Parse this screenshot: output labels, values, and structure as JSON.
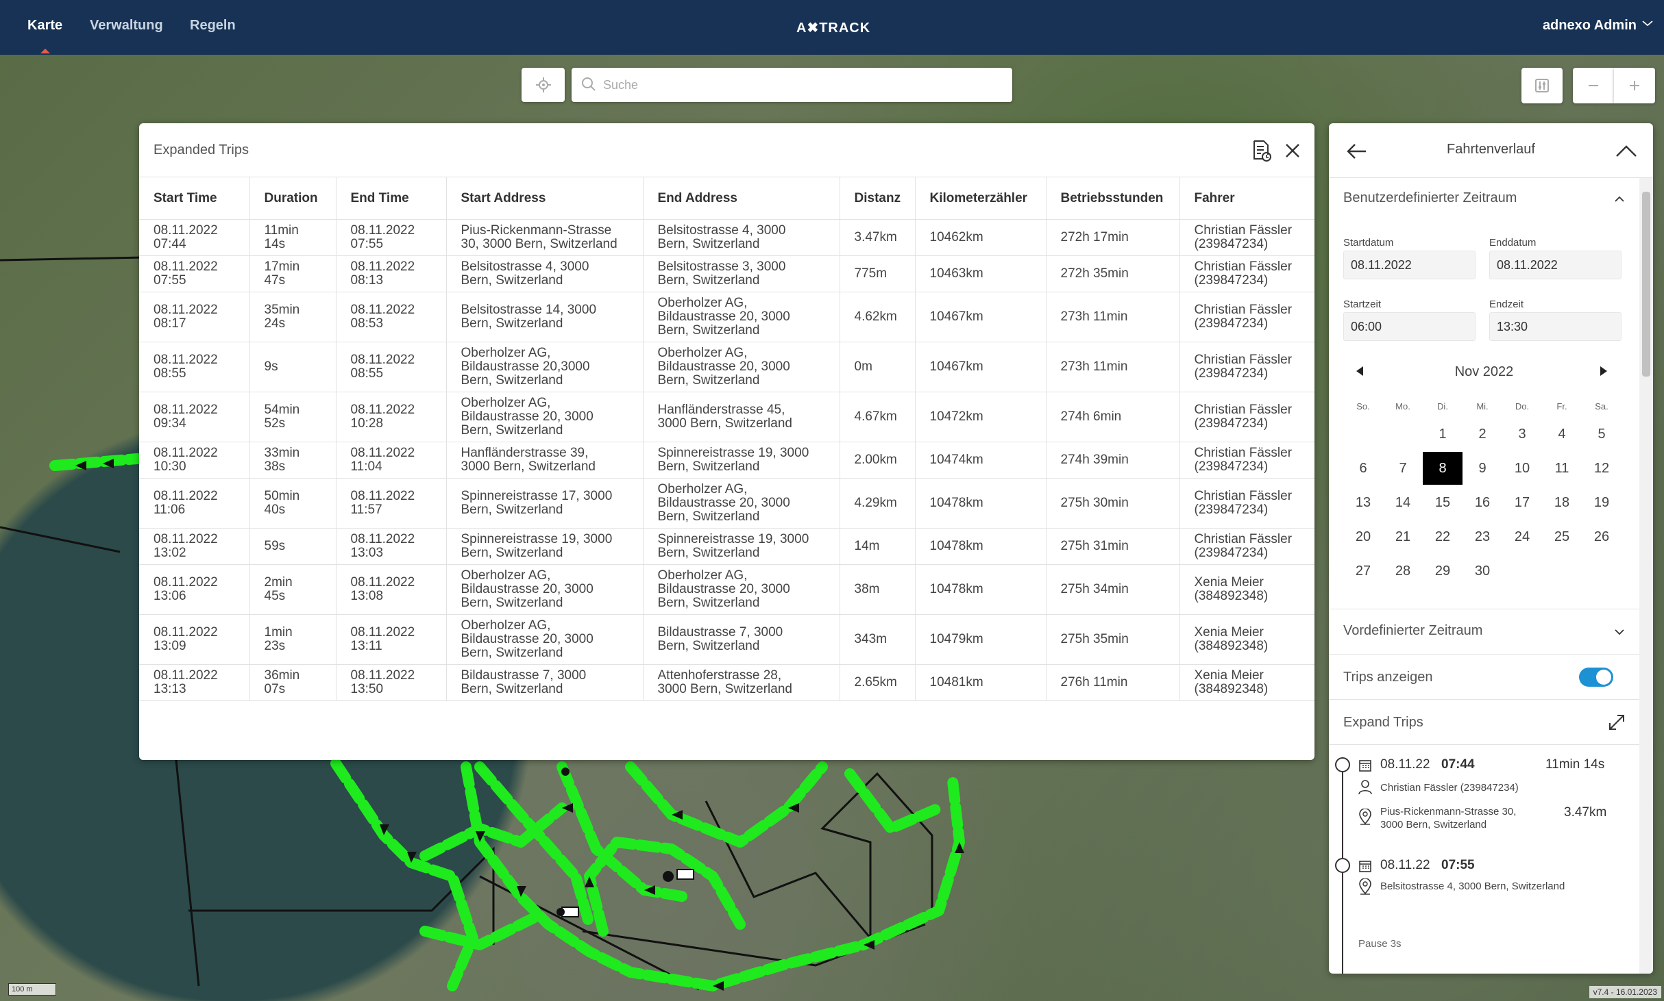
{
  "nav": {
    "items": [
      "Karte",
      "Verwaltung",
      "Regeln"
    ],
    "logo": "A✖TRACK",
    "user": "adnexo Admin"
  },
  "search": {
    "placeholder": "Suche"
  },
  "map": {
    "scale_label": "100 m",
    "version": "v7.4 - 16.01.2023"
  },
  "trips": {
    "title": "Expanded Trips",
    "columns": [
      "Start Time",
      "Duration",
      "End Time",
      "Start Address",
      "End Address",
      "Distanz",
      "Kilometerzähler",
      "Betriebsstunden",
      "Fahrer"
    ],
    "rows": [
      [
        "08.11.2022\n07:44",
        "11min\n14s",
        "08.11.2022\n07:55",
        "Pius-Rickenmann-Strasse\n30, 3000 Bern, Switzerland",
        "Belsitostrasse 4, 3000\nBern, Switzerland",
        "3.47km",
        "10462km",
        "272h 17min",
        "Christian Fässler\n(239847234)"
      ],
      [
        "08.11.2022\n07:55",
        "17min\n47s",
        "08.11.2022\n08:13",
        "Belsitostrasse 4, 3000\nBern, Switzerland",
        "Belsitostrasse 3, 3000\nBern, Switzerland",
        "775m",
        "10463km",
        "272h 35min",
        "Christian Fässler\n(239847234)"
      ],
      [
        "08.11.2022\n08:17",
        "35min\n24s",
        "08.11.2022\n08:53",
        "Belsitostrasse 14, 3000\nBern, Switzerland",
        "Oberholzer AG,\nBildaustrasse 20, 3000\nBern, Switzerland",
        "4.62km",
        "10467km",
        "273h 11min",
        "Christian Fässler\n(239847234)"
      ],
      [
        "08.11.2022\n08:55",
        "9s",
        "08.11.2022\n08:55",
        "Oberholzer AG,\nBildaustrasse 20,3000\nBern, Switzerland",
        "Oberholzer AG,\nBildaustrasse 20, 3000\nBern, Switzerland",
        "0m",
        "10467km",
        "273h 11min",
        "Christian Fässler\n(239847234)"
      ],
      [
        "08.11.2022\n09:34",
        "54min\n52s",
        "08.11.2022\n10:28",
        "Oberholzer AG,\nBildaustrasse 20, 3000\nBern, Switzerland",
        "Hanfländerstrasse 45,\n3000 Bern, Switzerland",
        "4.67km",
        "10472km",
        "274h 6min",
        "Christian Fässler\n(239847234)"
      ],
      [
        "08.11.2022\n10:30",
        "33min\n38s",
        "08.11.2022\n11:04",
        "Hanfländerstrasse 39,\n3000 Bern, Switzerland",
        "Spinnereistrasse 19, 3000\nBern, Switzerland",
        "2.00km",
        "10474km",
        "274h 39min",
        "Christian Fässler\n(239847234)"
      ],
      [
        "08.11.2022\n11:06",
        "50min\n40s",
        "08.11.2022\n11:57",
        "Spinnereistrasse 17, 3000\nBern, Switzerland",
        "Oberholzer AG,\nBildaustrasse 20, 3000\nBern, Switzerland",
        "4.29km",
        "10478km",
        "275h 30min",
        "Christian Fässler\n(239847234)"
      ],
      [
        "08.11.2022\n13:02",
        "59s",
        "08.11.2022\n13:03",
        "Spinnereistrasse 19, 3000\nBern, Switzerland",
        "Spinnereistrasse 19, 3000\nBern, Switzerland",
        "14m",
        "10478km",
        "275h 31min",
        "Christian Fässler\n(239847234)"
      ],
      [
        "08.11.2022\n13:06",
        "2min\n45s",
        "08.11.2022\n13:08",
        "Oberholzer AG,\nBildaustrasse 20, 3000\nBern, Switzerland",
        "Oberholzer AG,\nBildaustrasse 20, 3000\nBern, Switzerland",
        "38m",
        "10478km",
        "275h 34min",
        "Xenia Meier\n(384892348)"
      ],
      [
        "08.11.2022\n13:09",
        "1min\n23s",
        "08.11.2022\n13:11",
        "Oberholzer AG,\nBildaustrasse 20, 3000\nBern, Switzerland",
        "Bildaustrasse 7, 3000\nBern, Switzerland",
        "343m",
        "10479km",
        "275h 35min",
        "Xenia Meier\n(384892348)"
      ],
      [
        "08.11.2022\n13:13",
        "36min\n07s",
        "08.11.2022\n13:50",
        "Bildaustrasse 7, 3000\nBern, Switzerland",
        "Attenhoferstrasse 28,\n3000 Bern, Switzerland",
        "2.65km",
        "10481km",
        "276h 11min",
        "Xenia Meier\n(384892348)"
      ]
    ]
  },
  "panel": {
    "title": "Fahrtenverlauf",
    "custom_range": {
      "label": "Benutzerdefinierter Zeitraum",
      "start_date_label": "Startdatum",
      "start_date": "08.11.2022",
      "end_date_label": "Enddatum",
      "end_date": "08.11.2022",
      "start_time_label": "Startzeit",
      "start_time": "06:00",
      "end_time_label": "Endzeit",
      "end_time": "13:30"
    },
    "calendar": {
      "month": "Nov 2022",
      "weekdays": [
        "So.",
        "Mo.",
        "Di.",
        "Mi.",
        "Do.",
        "Fr.",
        "Sa."
      ],
      "first_weekday_index": 2,
      "days_in_month": 30,
      "selected_day": 8
    },
    "predefined_label": "Vordefinierter Zeitraum",
    "show_trips_label": "Trips anzeigen",
    "show_trips": true,
    "expand_trips_label": "Expand Trips",
    "timeline": {
      "trip1": {
        "date": "08.11.22",
        "time": "07:44",
        "duration": "11min 14s",
        "driver": "Christian Fässler (239847234)",
        "address": "Pius-Rickenmann-Strasse 30,\n3000 Bern, Switzerland",
        "distance": "3.47km"
      },
      "trip2": {
        "date": "08.11.22",
        "time": "07:55",
        "address": "Belsitostrasse 4, 3000 Bern, Switzerland"
      },
      "pause": "Pause 3s"
    }
  },
  "colors": {
    "topbar": "#173254",
    "track_green": "#1eea1e",
    "toggle_blue": "#1c91d4",
    "nav_active_marker": "#e35c4a"
  }
}
